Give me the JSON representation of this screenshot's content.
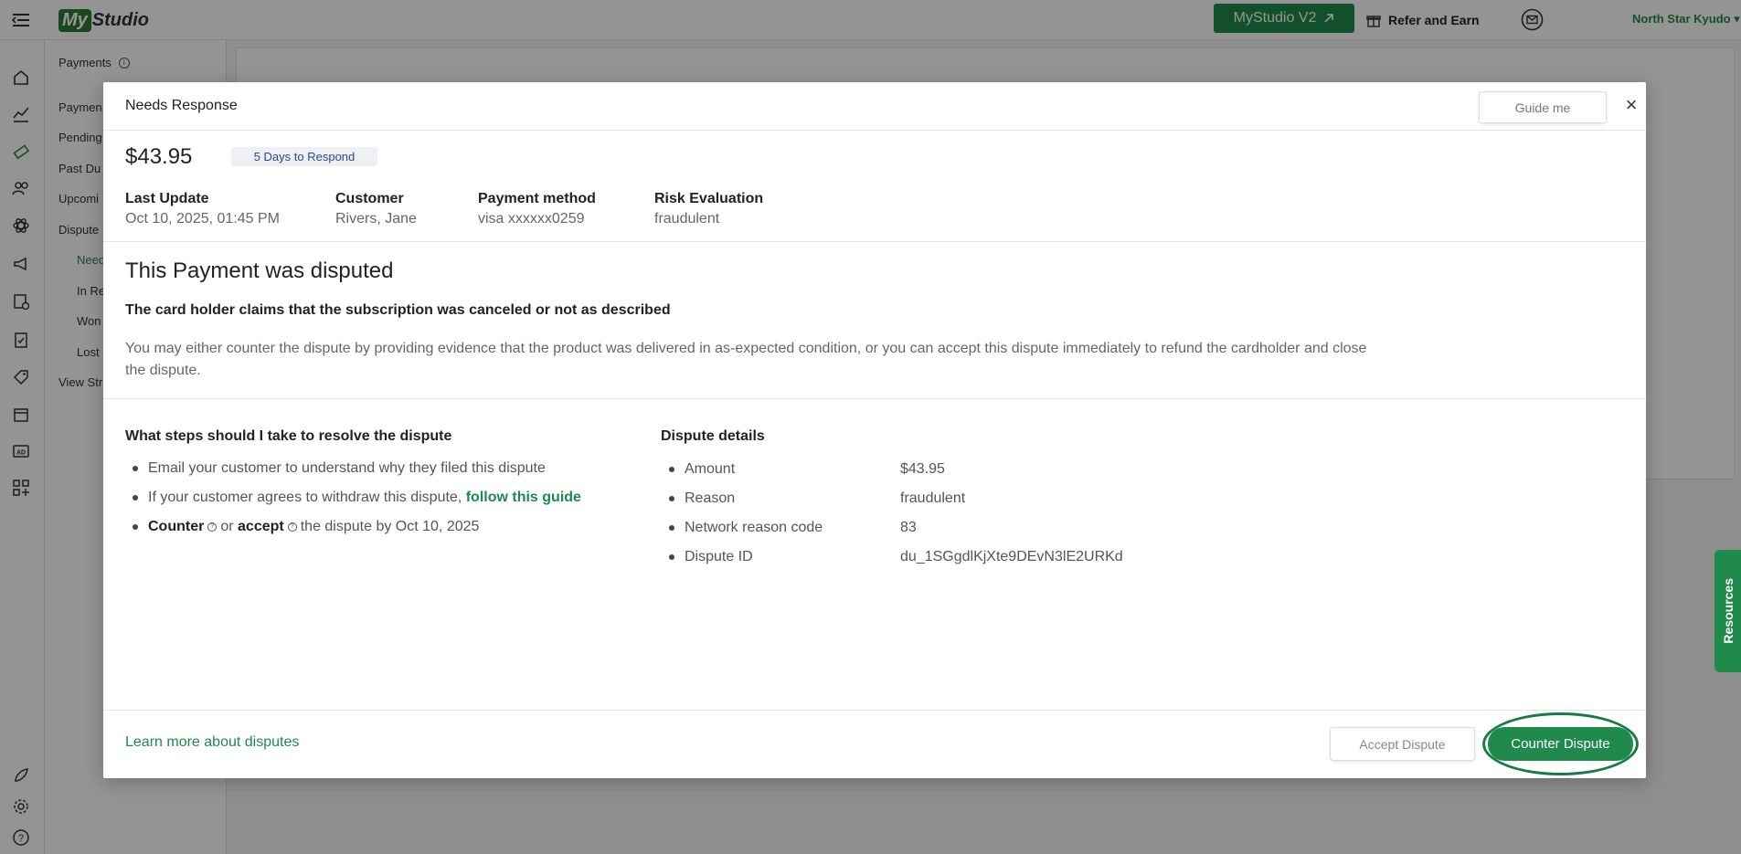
{
  "topbar": {
    "logo_my": "My",
    "logo_studio": "Studio",
    "v2_label": "MyStudio V2",
    "refer_label": "Refer and Earn",
    "studio_name": "North Star Kyudo"
  },
  "subnav": {
    "title": "Payments",
    "items": [
      "Paymen",
      "Pending",
      "Past Du",
      "Upcomi",
      "Dispute"
    ],
    "sub_items": [
      "Need",
      "In Re",
      "Won",
      "Lost"
    ],
    "view_stripe": "View Str"
  },
  "resources_label": "Resources",
  "modal": {
    "title": "Needs Response",
    "guide_label": "Guide me",
    "close_label": "×",
    "amount": "$43.95",
    "respond_badge": "5 Days to Respond",
    "meta": [
      {
        "key": "Last Update",
        "value": "Oct 10, 2025, 01:45 PM"
      },
      {
        "key": "Customer",
        "value": "Rivers, Jane"
      },
      {
        "key": "Payment method",
        "value": "visa xxxxxx0259"
      },
      {
        "key": "Risk Evaluation",
        "value": "fraudulent"
      }
    ],
    "disputed_heading": "This Payment was disputed",
    "claim": "The card holder claims that the subscription was canceled or not as described",
    "paragraph": "You may either counter the dispute by providing evidence that the product was delivered in as-expected condition, or you can accept this dispute immediately to refund the cardholder and close the dispute.",
    "steps_heading": "What steps should I take to resolve the dispute",
    "steps": {
      "s1": "Email your customer to understand why they filed this dispute",
      "s2_prefix": "If your customer agrees to withdraw this dispute, ",
      "s2_link": "follow this guide",
      "s3_counter": "Counter",
      "s3_or": "or",
      "s3_accept": "accept",
      "s3_suffix": "the dispute by Oct 10, 2025"
    },
    "details_heading": "Dispute details",
    "details": [
      {
        "key": "Amount",
        "value": "$43.95"
      },
      {
        "key": "Reason",
        "value": "fraudulent"
      },
      {
        "key": "Network reason code",
        "value": "83"
      },
      {
        "key": "Dispute ID",
        "value": "du_1SGgdlKjXte9DEvN3lE2URKd"
      }
    ],
    "learn_more": "Learn more about disputes",
    "accept_label": "Accept Dispute",
    "counter_label": "Counter Dispute"
  },
  "colors": {
    "brand_green": "#1f8a4c",
    "badge_text": "#2b4a8a"
  }
}
